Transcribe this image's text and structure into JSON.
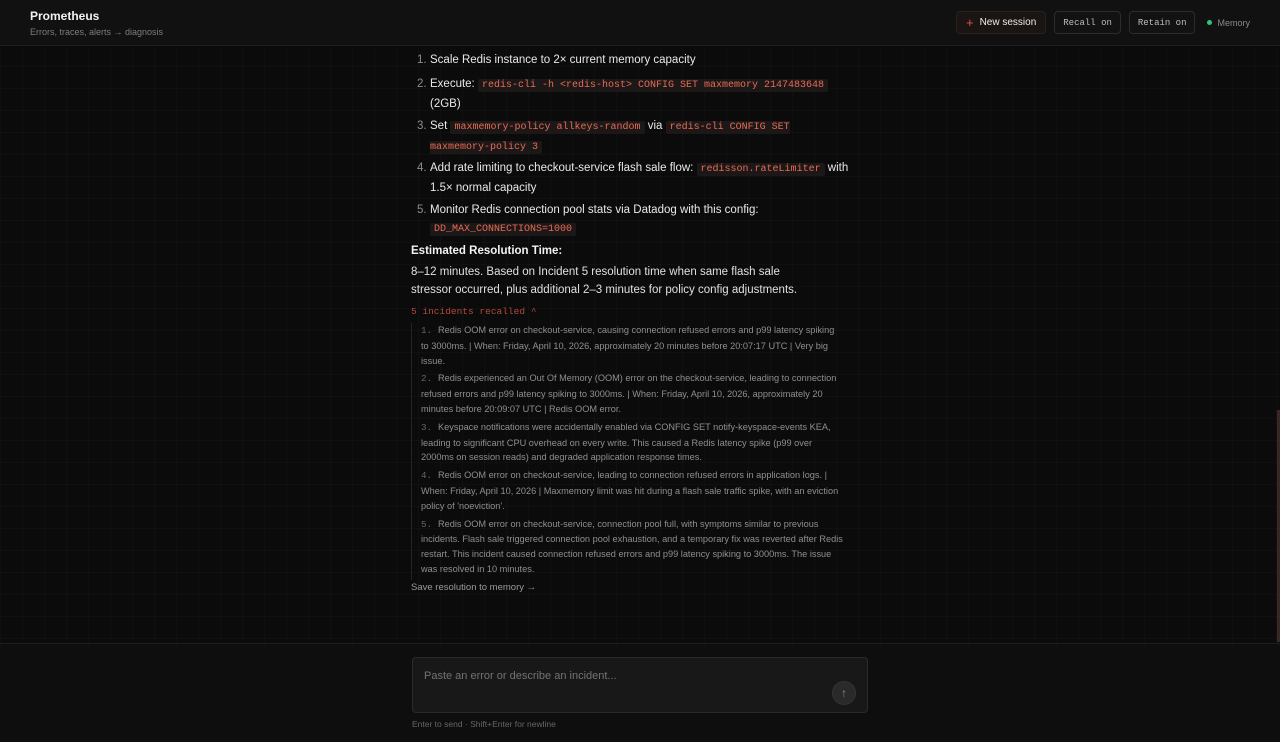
{
  "header": {
    "title": "Prometheus",
    "subtitle": "Errors, traces, alerts → diagnosis",
    "new_session_label": "New session",
    "recall_label": "Recall on",
    "retain_label": "Retain on",
    "memory_label": "Memory",
    "memory_status_color": "#33c27a",
    "accent_color": "#e0533d"
  },
  "steps": [
    {
      "num": "1.",
      "pre": "Scale Redis instance to 2× current memory capacity"
    },
    {
      "num": "2.",
      "pre": "Execute: ",
      "code": "redis-cli -h <redis-host> CONFIG SET maxmemory 2147483648",
      "post": " (2GB)"
    },
    {
      "num": "3.",
      "pre": "Set ",
      "code": "maxmemory-policy allkeys-random",
      "mid": " via ",
      "code2": "redis-cli CONFIG SET maxmemory-policy 3"
    },
    {
      "num": "4.",
      "pre": "Add rate limiting to checkout-service flash sale flow: ",
      "code": "redisson.rateLimiter",
      "post": " with 1.5× normal capacity"
    },
    {
      "num": "5.",
      "pre": "Monitor Redis connection pool stats via Datadog with this config: ",
      "code": "DD_MAX_CONNECTIONS=1000"
    }
  ],
  "resolution": {
    "title": "Estimated Resolution Time:",
    "body": "8–12 minutes. Based on Incident 5 resolution time when same flash sale stressor occurred, plus additional 2–3 minutes for policy config adjustments."
  },
  "recall": {
    "toggle_label": "5 incidents recalled",
    "incidents": [
      {
        "num": "1.",
        "text": "Redis OOM error on checkout-service, causing connection refused errors and p99 latency spiking to 3000ms. | When: Friday, April 10, 2026, approximately 20 minutes before 20:07:17 UTC | Very big issue."
      },
      {
        "num": "2.",
        "text": "Redis experienced an Out Of Memory (OOM) error on the checkout-service, leading to connection refused errors and p99 latency spiking to 3000ms. | When: Friday, April 10, 2026, approximately 20 minutes before 20:09:07 UTC | Redis OOM error."
      },
      {
        "num": "3.",
        "text": "Keyspace notifications were accidentally enabled via CONFIG SET notify-keyspace-events KEA, leading to significant CPU overhead on every write. This caused a Redis latency spike (p99 over 2000ms on session reads) and degraded application response times."
      },
      {
        "num": "4.",
        "text": "Redis OOM error on checkout-service, leading to connection refused errors in application logs. | When: Friday, April 10, 2026 | Maxmemory limit was hit during a flash sale traffic spike, with an eviction policy of 'noeviction'."
      },
      {
        "num": "5.",
        "text": "Redis OOM error on checkout-service, connection pool full, with symptoms similar to previous incidents. Flash sale triggered connection pool exhaustion, and a temporary fix was reverted after Redis restart. This incident caused connection refused errors and p99 latency spiking to 3000ms. The issue was resolved in 10 minutes."
      }
    ],
    "save_label": "Save resolution to memory →"
  },
  "composer": {
    "placeholder": "Paste an error or describe an incident...",
    "value": "",
    "hint": "Enter to send · Shift+Enter for newline"
  }
}
